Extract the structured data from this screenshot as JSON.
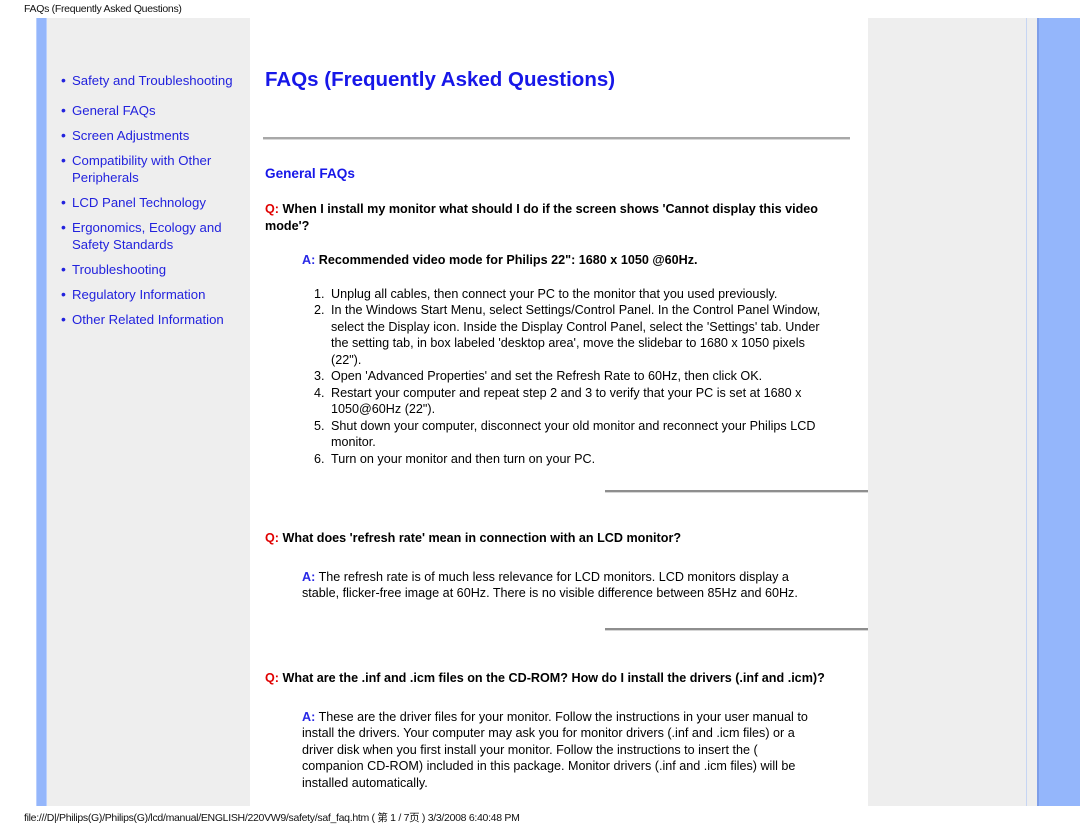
{
  "print": {
    "header": "FAQs (Frequently Asked Questions)",
    "footer": "file:///D|/Philips(G)/Philips(G)/lcd/manual/ENGLISH/220VW9/safety/saf_faq.htm ( 第 1 / 7页 ) 3/3/2008 6:40:48 PM"
  },
  "colors": {
    "link_blue": "#2222dd",
    "title_blue": "#1717e8",
    "q_red": "#e00000",
    "a_blue": "#2828e6",
    "bar_blue": "#94b6fb",
    "sidebar_gray": "#eeeeee"
  },
  "sidebar": {
    "items": [
      {
        "label": "Safety and Troubleshooting"
      },
      {
        "label": "General FAQs"
      },
      {
        "label": "Screen Adjustments"
      },
      {
        "label": "Compatibility with Other Peripherals"
      },
      {
        "label": "LCD Panel Technology"
      },
      {
        "label": "Ergonomics, Ecology and Safety Standards"
      },
      {
        "label": "Troubleshooting"
      },
      {
        "label": "Regulatory Information"
      },
      {
        "label": "Other Related Information"
      }
    ]
  },
  "main": {
    "title": "FAQs (Frequently Asked Questions)",
    "section_heading": "General FAQs",
    "q_prefix": "Q:",
    "a_prefix": "A:",
    "qa": [
      {
        "question": "When I install my monitor what should I do if the screen shows 'Cannot display this video mode'?",
        "answer_bold": "Recommended video mode for Philips 22\": 1680 x 1050 @60Hz.",
        "steps": [
          "Unplug all cables, then connect your PC to the monitor that you used previously.",
          "In the Windows Start Menu, select Settings/Control Panel. In the Control Panel Window, select the Display icon. Inside the Display Control Panel, select the 'Settings' tab. Under the setting tab, in box labeled 'desktop area', move the slidebar to 1680 x 1050 pixels (22\").",
          "Open 'Advanced Properties' and set the Refresh Rate to 60Hz, then click OK.",
          "Restart your computer and repeat step 2 and 3 to verify that your PC is set at 1680 x 1050@60Hz (22\").",
          "Shut down your computer, disconnect your old monitor and reconnect your Philips LCD monitor.",
          "Turn on your monitor and then turn on your PC."
        ]
      },
      {
        "question": "What does 'refresh rate' mean in connection with an LCD monitor?",
        "answer": "The refresh rate is of much less relevance for LCD monitors. LCD monitors display a stable, flicker-free image at 60Hz. There is no visible difference between 85Hz and 60Hz."
      },
      {
        "question": "What are the .inf and .icm files on the CD-ROM? How do I install the drivers (.inf and .icm)?",
        "answer": "These are the driver files for your monitor. Follow the instructions in your user manual to install the drivers. Your computer may ask you for monitor drivers (.inf and .icm files) or a driver disk when you first install your monitor. Follow the instructions to insert the ( companion CD-ROM) included in this package. Monitor drivers (.inf and .icm files) will be installed automatically."
      }
    ]
  }
}
